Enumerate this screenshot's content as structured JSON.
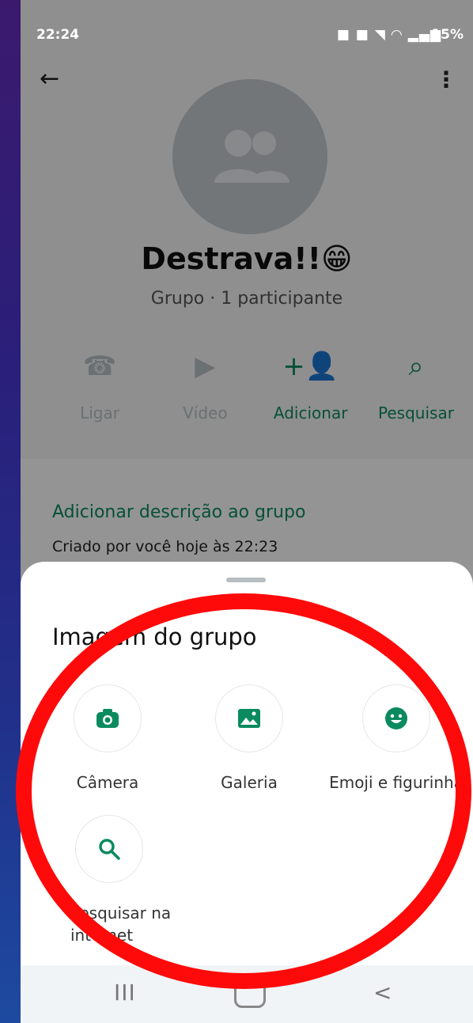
{
  "status_bar": {
    "time": "22:24",
    "icons": "■ ■ ◥ ◠ ▂▄▆",
    "battery": "15%"
  },
  "header": {
    "group_name": "Destrava!!",
    "group_emoji": "😁",
    "subtitle": "Grupo · 1 participante"
  },
  "actions": [
    {
      "label": "Ligar",
      "icon": "phone-icon",
      "glyph": "☎"
    },
    {
      "label": "Vídeo",
      "icon": "video-icon",
      "glyph": "▶"
    },
    {
      "label": "Adicionar",
      "icon": "add-person-icon",
      "glyph": "+👤"
    },
    {
      "label": "Pesquisar",
      "icon": "search-icon",
      "glyph": "⌕"
    }
  ],
  "info": {
    "description_link": "Adicionar descrição ao grupo",
    "created_by": "Criado por você hoje às 22:23"
  },
  "sheet": {
    "title": "Imagem do grupo",
    "options": [
      {
        "label": "Câmera",
        "icon": "camera-icon"
      },
      {
        "label": "Galeria",
        "icon": "gallery-icon"
      },
      {
        "label": "Emoji e figurinha",
        "icon": "emoji-icon"
      },
      {
        "label": "Pesquisar na internet",
        "icon": "search-icon"
      }
    ]
  },
  "navigation": {
    "recents": "III",
    "back": "<"
  },
  "colors": {
    "accent": "#0b8a5f",
    "highlight": "#ff0a0a"
  }
}
